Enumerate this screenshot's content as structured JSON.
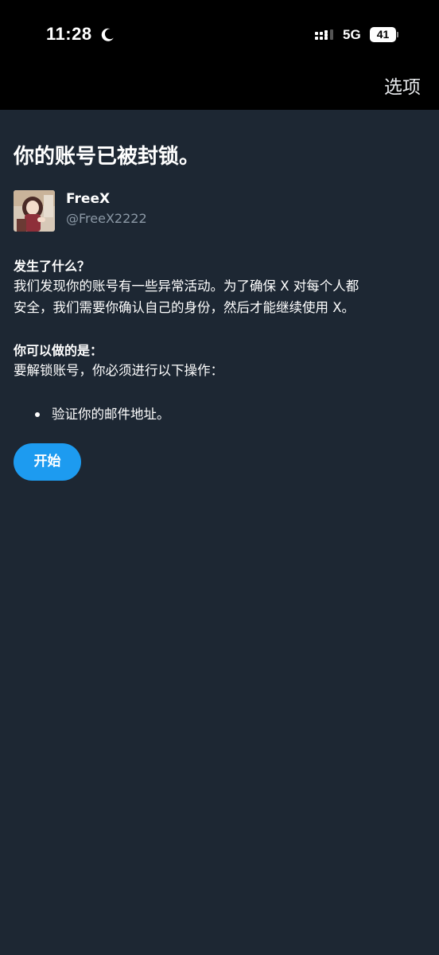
{
  "status_bar": {
    "time": "11:28",
    "network": "5G",
    "battery": "41",
    "icons": [
      "moon-icon",
      "signal-icon",
      "battery-icon"
    ]
  },
  "header": {
    "options_label": "选项"
  },
  "page": {
    "title": "你的账号已被封锁。"
  },
  "account": {
    "display_name": "FreeX",
    "handle": "@FreeX2222"
  },
  "what_happened": {
    "heading": "发生了什么？",
    "line1": "我们发现你的账号有一些异常活动。为了确保 X 对每个人都",
    "line2": "安全，我们需要你确认自己的身份，然后才能继续使用 X。"
  },
  "what_you_can_do": {
    "heading": "你可以做的是：",
    "intro": "要解锁账号，你必须进行以下操作：",
    "items": [
      {
        "label": "验证你的邮件地址。"
      }
    ]
  },
  "actions": {
    "start_label": "开始"
  },
  "colors": {
    "background": "#1d2733",
    "header_background": "#000000",
    "accent": "#1d9bf0",
    "secondary_text": "#8b98a5"
  }
}
